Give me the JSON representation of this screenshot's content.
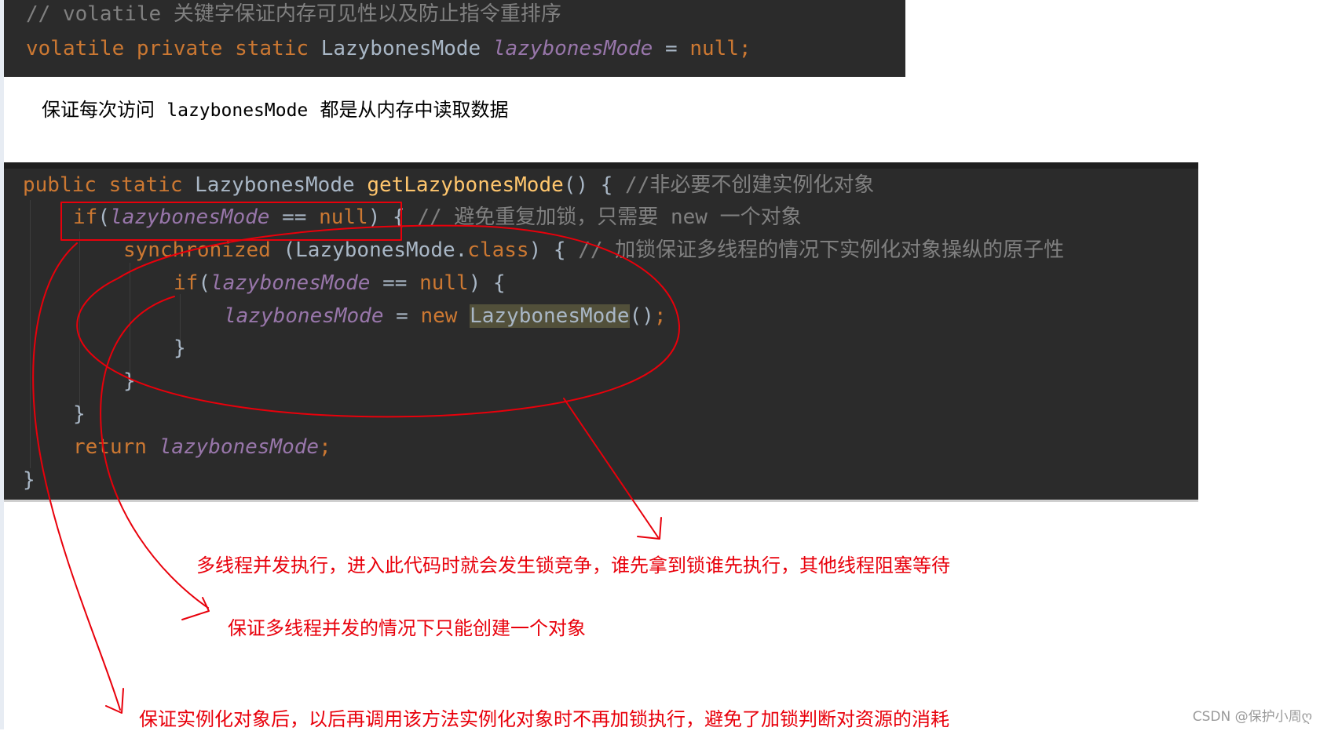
{
  "top_code": {
    "comment": "// volatile 关键字保证内存可见性以及防止指令重排序",
    "decl_keywords": "volatile private static",
    "decl_type": "LazybonesMode",
    "decl_field": "lazybonesMode",
    "decl_assign": " = ",
    "decl_null": "null;"
  },
  "note": {
    "prefix": "保证每次访问",
    "field": "lazybonesMode",
    "suffix": "都是从内存中读取数据"
  },
  "main_code": {
    "l1_kw": "public static",
    "l1_type": " LazybonesMode ",
    "l1_fn": "getLazybonesMode",
    "l1_rest": "() { ",
    "l1_comment": "//非必要不创建实例化对象",
    "l2_kw": "if",
    "l2_open": "(",
    "l2_field": "lazybonesMode",
    "l2_eq": " == ",
    "l2_null": "null",
    "l2_rest": ") { ",
    "l2_comment": "// 避免重复加锁，只需要 new 一个对象",
    "l3_kw": "synchronized",
    "l3_rest1": " (LazybonesMode.",
    "l3_class": "class",
    "l3_rest2": ") { ",
    "l3_comment": "// 加锁保证多线程的情况下实例化对象操纵的原子性",
    "l4_kw": "if",
    "l4_open": "(",
    "l4_field": "lazybonesMode",
    "l4_eq": " == ",
    "l4_null": "null",
    "l4_rest": ") {",
    "l5_field": "lazybonesMode",
    "l5_eq": " = ",
    "l5_new": "new",
    "l5_sp": " ",
    "l5_type": "LazybonesMode",
    "l5_paren": "()",
    "l5_semi": ";",
    "l6_brace": "}",
    "l7_brace": "}",
    "l8_brace": "}",
    "l9_kw": "return",
    "l9_field": "lazybonesMode",
    "l9_semi": ";",
    "l10_brace": "}"
  },
  "annotations": {
    "lock_contention": "多线程并发执行，进入此代码时就会发生锁竞争，谁先拿到锁谁先执行，其他线程阻塞等待",
    "single_instance": "保证多线程并发的情况下只能创建一个对象",
    "no_relock": "保证实例化对象后，以后再调用该方法实例化对象时不再加锁执行，避免了加锁判断对资源的消耗"
  },
  "watermark": "CSDN @保护小周ღ",
  "colors": {
    "editor_bg": "#2b2b2b",
    "keyword": "#cc7832",
    "field": "#9876aa",
    "comment": "#808080",
    "method": "#ffc66d",
    "plain": "#a9b7c6",
    "annotation_red": "#e8000b"
  }
}
